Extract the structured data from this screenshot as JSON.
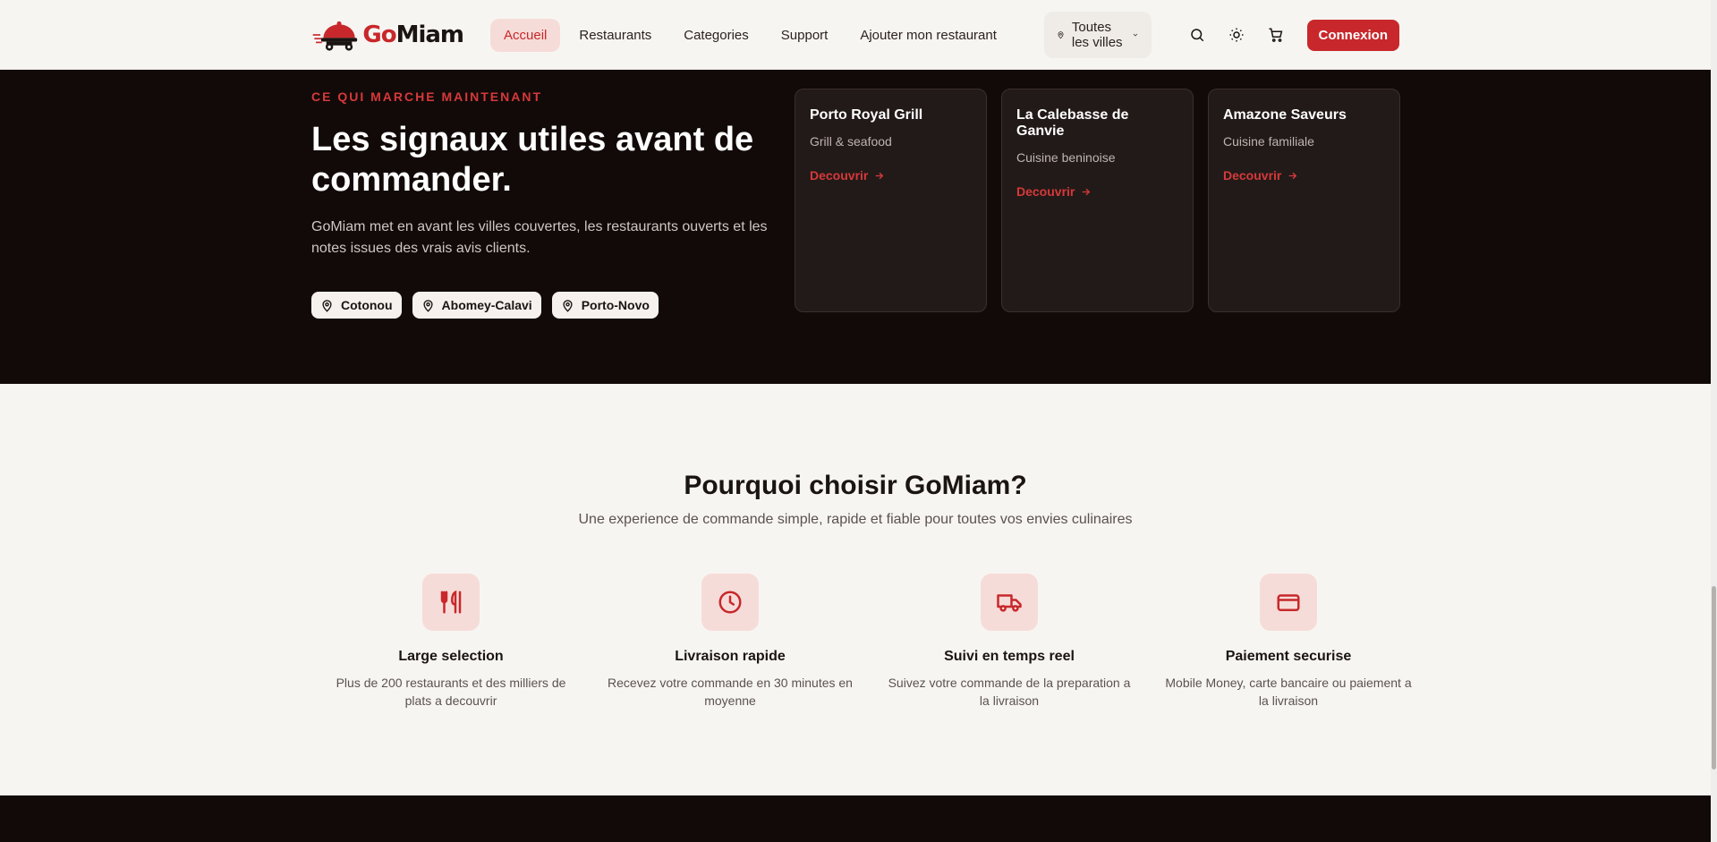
{
  "nav": {
    "logo_go": "Go",
    "logo_miam": "Miam",
    "links": [
      "Accueil",
      "Restaurants",
      "Categories",
      "Support",
      "Ajouter mon restaurant"
    ],
    "city_select": "Toutes les villes",
    "login": "Connexion"
  },
  "hero": {
    "eyebrow": "CE QUI MARCHE MAINTENANT",
    "headline": "Les signaux utiles avant de commander.",
    "lede": "GoMiam met en avant les villes couvertes, les restaurants ouverts et les notes issues des vrais avis clients.",
    "cities": [
      "Cotonou",
      "Abomey-Calavi",
      "Porto-Novo"
    ]
  },
  "cards": [
    {
      "name": "Porto Royal Grill",
      "cuisine": "Grill & seafood",
      "link": "Decouvrir"
    },
    {
      "name": "La Calebasse de Ganvie",
      "cuisine": "Cuisine beninoise",
      "link": "Decouvrir"
    },
    {
      "name": "Amazone Saveurs",
      "cuisine": "Cuisine familiale",
      "link": "Decouvrir"
    }
  ],
  "why": {
    "title": "Pourquoi choisir GoMiam?",
    "subtitle": "Une experience de commande simple, rapide et fiable pour toutes vos envies culinaires",
    "features": [
      {
        "icon": "utensils-icon",
        "title": "Large selection",
        "desc": "Plus de 200 restaurants et des milliers de plats a decouvrir"
      },
      {
        "icon": "clock-icon",
        "title": "Livraison rapide",
        "desc": "Recevez votre commande en 30 minutes en moyenne"
      },
      {
        "icon": "truck-icon",
        "title": "Suivi en temps reel",
        "desc": "Suivez votre commande de la preparation a la livraison"
      },
      {
        "icon": "credit-card-icon",
        "title": "Paiement securise",
        "desc": "Mobile Money, carte bancaire ou paiement a la livraison"
      }
    ]
  },
  "colors": {
    "accent": "#c8282b",
    "dark": "#120a08",
    "card": "#221a18",
    "accent_soft": "#f6dcd8"
  }
}
